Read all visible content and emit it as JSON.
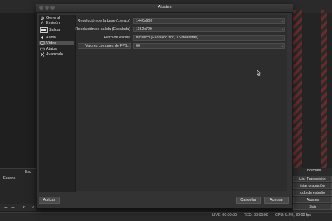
{
  "dialog": {
    "title": "Ajustes",
    "sidebar": [
      {
        "label": "General",
        "icon": "gear-icon"
      },
      {
        "label": "Emisión",
        "icon": "broadcast-icon"
      },
      {
        "label": "Salida",
        "icon": "output-icon"
      },
      {
        "label": "Audio",
        "icon": "speaker-icon"
      },
      {
        "label": "Vídeo",
        "icon": "monitor-icon",
        "selected": true
      },
      {
        "label": "Atajos",
        "icon": "keyboard-icon"
      },
      {
        "label": "Avanzado",
        "icon": "tools-icon"
      }
    ],
    "video": {
      "base_resolution_label": "Resolución de la base (Lienzo)",
      "base_resolution_value": "1440x900",
      "output_resolution_label": "Resolución de salida (Escalada)",
      "output_resolution_value": "1152x720",
      "scale_filter_label": "Filtro de escala",
      "scale_filter_value": "Bicúbico (Escalado fino, 16 muestras)",
      "fps_type_value": "Valores comunes de FPS",
      "fps_value": "60"
    },
    "buttons": {
      "apply": "Aplicar",
      "cancel": "Cancelar",
      "accept": "Aceptar"
    }
  },
  "main": {
    "scenes_header": "Esc",
    "scenes_item": "Escena",
    "controls": {
      "title": "Controles",
      "start_stream": "iciar Transmisión",
      "start_recording": "iciar grabación",
      "studio_mode": "odo de estudio",
      "settings": "Ajustes",
      "exit": "Salir"
    },
    "status": {
      "live": "LIVE: 00:00:00",
      "rec": "REC: 00:00:00",
      "cpu": "CPU: 5.2%, 30.00 fps"
    }
  }
}
